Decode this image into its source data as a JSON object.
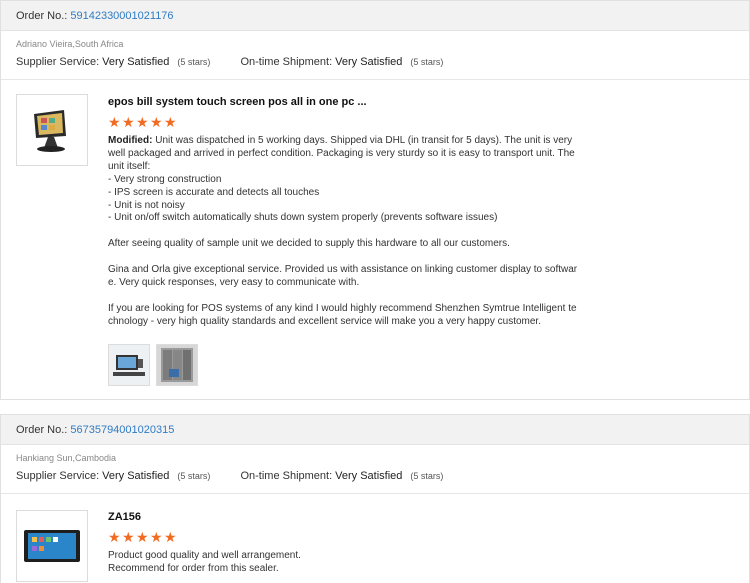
{
  "orders": [
    {
      "order_label": "Order No.:",
      "order_number": "59142330001021176",
      "buyer": "Adriano Vieira,South Africa",
      "supplier_service_label": "Supplier Service:",
      "supplier_service_value": "Very Satisfied",
      "supplier_service_stars": "(5 stars)",
      "shipment_label": "On-time Shipment:",
      "shipment_value": "Very Satisfied",
      "shipment_stars": "(5 stars)",
      "product_title": "epos bill system touch screen pos all in one pc ...",
      "rating": 5,
      "modified_label": "Modified:",
      "review_lines": [
        "Unit was dispatched in 5 working days. Shipped via DHL (in transit for 5 days). The unit is very well packaged and arrived in perfect condition. Packaging is very sturdy so it is easy to transport unit. The unit itself:",
        "- Very strong construction",
        "- IPS screen is accurate and detects all touches",
        "- Unit is not noisy",
        "- Unit on/off switch automatically shuts down system properly (prevents software issues)",
        "",
        "After seeing quality of sample unit we decided to supply this hardware to all our customers.",
        "",
        "Gina and Orla give exceptional service. Provided us with assistance on linking customer display to software. Very quick responses, very easy to communicate with.",
        "",
        "If you are looking for POS systems of any kind I would highly recommend Shenzhen Symtrue Intelligent technology - very high quality standards and excellent service will make you a very happy customer."
      ],
      "photo_icons": [
        "pos-terminal-photo-icon",
        "boxed-units-photo-icon"
      ]
    },
    {
      "order_label": "Order No.:",
      "order_number": "56735794001020315",
      "buyer": "Hankiang Sun,Cambodia",
      "supplier_service_label": "Supplier Service:",
      "supplier_service_value": "Very Satisfied",
      "supplier_service_stars": "(5 stars)",
      "shipment_label": "On-time Shipment:",
      "shipment_value": "Very Satisfied",
      "shipment_stars": "(5 stars)",
      "product_title": "ZA156",
      "rating": 5,
      "review_lines": [
        "Product good quality and well arrangement.",
        "Recommend for order from this sealer."
      ]
    }
  ],
  "colors": {
    "link": "#2f7bc4",
    "star": "#f26b21",
    "header_bg": "#f2f2f2"
  }
}
